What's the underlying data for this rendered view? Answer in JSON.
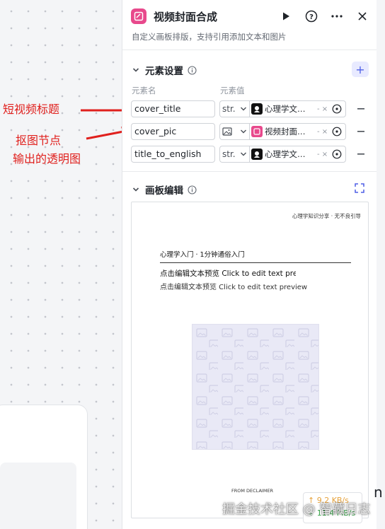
{
  "annotations": {
    "arrow1_label": "短视频标题",
    "arrow2_line1": "抠图节点",
    "arrow2_line2": "输出的透明图"
  },
  "panel": {
    "title": "视频封面合成",
    "subtitle": "自定义画板排版，支持引用添加文本和图片",
    "header_icons": [
      "play-icon",
      "help-icon",
      "more-icon",
      "close-icon"
    ],
    "elements_section": {
      "title": "元素设置",
      "add_label": "+",
      "col_name": "元素名",
      "col_value": "元素值",
      "rows": [
        {
          "name": "cover_title",
          "type": "str.",
          "value_icon": "avatar-icon",
          "value": "心理学文…",
          "suffix": "- ×"
        },
        {
          "name": "cover_pic",
          "type_icon": "image-icon",
          "value_icon": "pink-app-icon",
          "value": "视频封面…",
          "suffix": "- ×"
        },
        {
          "name": "title_to_english",
          "type": "str.",
          "value_icon": "avatar-icon",
          "value": "心理学文…",
          "suffix": "- ×"
        }
      ]
    },
    "board_section": {
      "title": "画板编辑",
      "board": {
        "top_right_text": "心理学知识分享 · 无不良引导",
        "heading": "心理学入门 · 1分钟通俗入门",
        "text1": "点击编辑文本预览 Click to edit text previ",
        "text2": "点击编辑文本预览 Click to edit text preview",
        "footer": "FROM DECLAIMER"
      }
    }
  },
  "speed_widget": {
    "up": "↑ 9.2 KB/s",
    "down": "↓ 11.4 MB/s"
  },
  "watermark": "掘金技术社区 @ 智藏日志",
  "stray_char": "n",
  "colors": {
    "accent": "#4e5fe6",
    "app_icon": "#e8498c",
    "annotation_red": "#e0201d"
  }
}
